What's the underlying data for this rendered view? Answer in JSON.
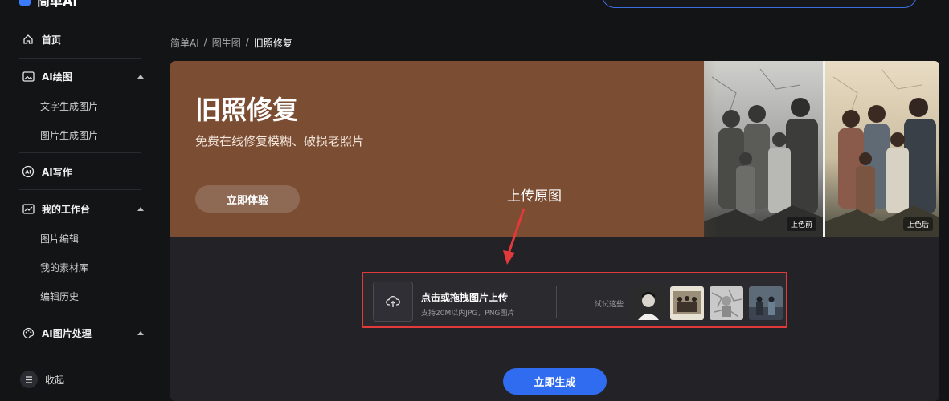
{
  "app": {
    "name": "简单AI"
  },
  "sidebar": {
    "home": "首页",
    "ai_drawing": "AI绘图",
    "text_to_image": "文字生成图片",
    "image_to_image": "图片生成图片",
    "ai_writing": "AI写作",
    "workbench": "我的工作台",
    "image_edit": "图片编辑",
    "materials": "我的素材库",
    "edit_history": "编辑历史",
    "ai_image_processing": "AI图片处理",
    "collapse": "收起"
  },
  "breadcrumb": [
    "简单AI",
    "/",
    "图生图",
    "/",
    "旧照修复"
  ],
  "banner": {
    "title": "旧照修复",
    "subtitle": "免费在线修复模糊、破损老照片",
    "try_button": "立即体验",
    "before_tag": "上色前",
    "after_tag": "上色后"
  },
  "annotation": {
    "label": "上传原图",
    "color": "#e23a3a"
  },
  "upload": {
    "title": "点击或拖拽图片上传",
    "hint": "支持20M以内JPG，PNG图片",
    "try_these": "试试这些"
  },
  "generate_button": "立即生成",
  "colors": {
    "accent": "#2f6cf0",
    "banner": "#7b4d33",
    "highlight": "#e23a3a"
  }
}
